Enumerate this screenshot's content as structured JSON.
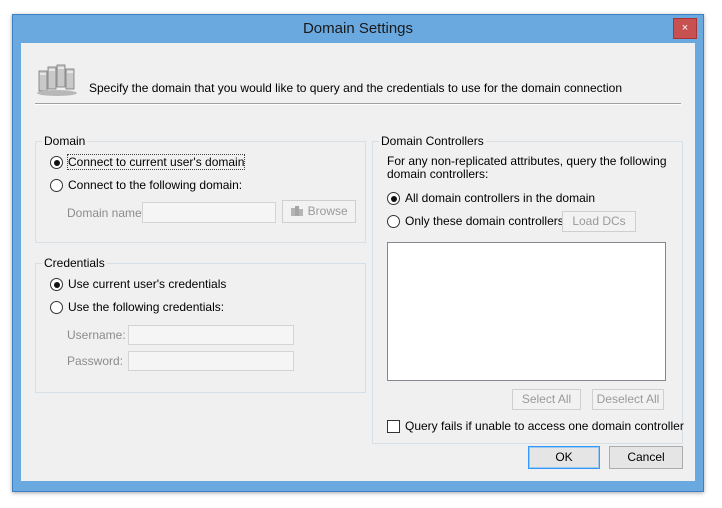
{
  "window": {
    "title": "Domain Settings",
    "close_glyph": "×"
  },
  "header": {
    "icon": "server-domain-icon",
    "text": "Specify the domain that you would like to query and the credentials to use for the domain connection"
  },
  "domain": {
    "label": "Domain",
    "opt_current": "Connect to current user's domain",
    "opt_following": "Connect to the following domain:",
    "selected": "current",
    "name_label": "Domain name:",
    "name_value": "",
    "browse_label": "Browse"
  },
  "credentials": {
    "label": "Credentials",
    "opt_current": "Use current user's credentials",
    "opt_following": "Use the following credentials:",
    "selected": "current",
    "username_label": "Username:",
    "username_value": "",
    "password_label": "Password:",
    "password_value": ""
  },
  "dc": {
    "label": "Domain Controllers",
    "description": "For any non-replicated attributes, query the following domain controllers:",
    "opt_all": "All domain controllers in the domain",
    "opt_only": "Only these domain controllers:",
    "selected": "all",
    "load_label": "Load DCs",
    "select_all_label": "Select All",
    "deselect_all_label": "Deselect All",
    "query_fails_label": "Query fails if unable to access one domain controller",
    "query_fails_checked": false
  },
  "footer": {
    "ok_label": "OK",
    "cancel_label": "Cancel"
  }
}
